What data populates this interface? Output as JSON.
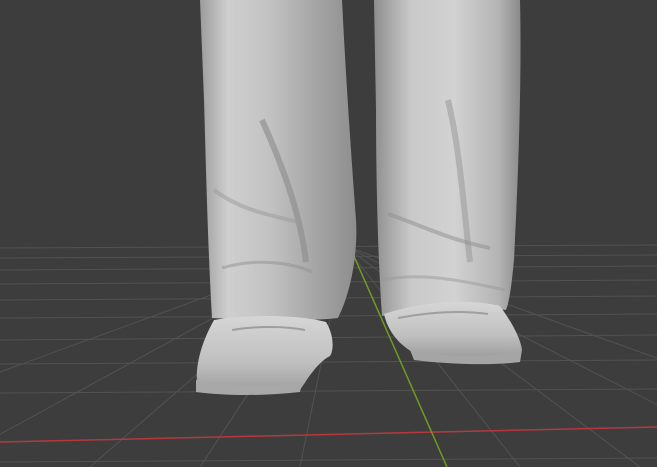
{
  "viewport": {
    "mode": "sculpt-viewport-3d",
    "background_color": "#3d3d3d",
    "grid_color": "#525252",
    "x_axis_color": "#b3393f",
    "y_axis_color": "#6f9a24",
    "model_color": "#c4c4c4",
    "model": "trousers-and-shoes-sculpt"
  }
}
